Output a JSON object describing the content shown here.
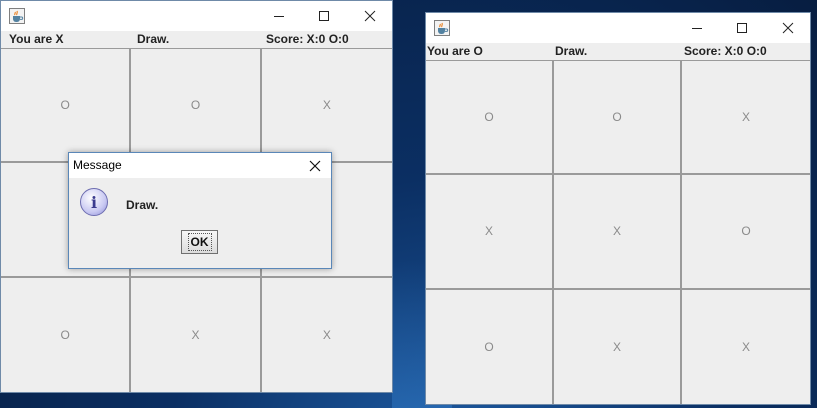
{
  "left_window": {
    "status": {
      "player": "You are X",
      "message": "Draw.",
      "score": "Score: X:0 O:0"
    },
    "cells": [
      "O",
      "O",
      "X",
      "",
      "",
      "",
      "O",
      "X",
      "X"
    ]
  },
  "right_window": {
    "status": {
      "player": "You are O",
      "message": "Draw.",
      "score": "Score: X:0 O:0"
    },
    "cells": [
      "O",
      "O",
      "X",
      "X",
      "X",
      "O",
      "O",
      "X",
      "X"
    ]
  },
  "dialog": {
    "title": "Message",
    "message": "Draw.",
    "ok_label": "OK"
  },
  "icons": {
    "app": "java-cup-icon",
    "minimize": "minimize-icon",
    "maximize": "maximize-icon",
    "close": "close-icon",
    "info": "info-icon"
  },
  "colors": {
    "board_bg": "#eeeeee",
    "grid_line": "#9a9a9a",
    "mark": "#8a8a8a",
    "dialog_border": "#5a87b8",
    "desktop": "#0b2f63"
  }
}
